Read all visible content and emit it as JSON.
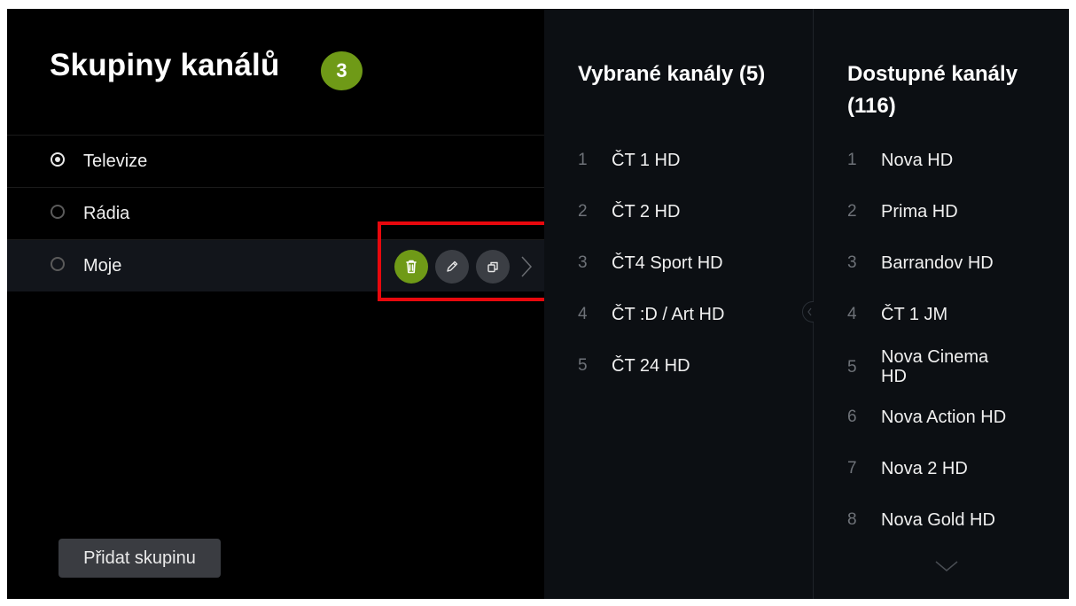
{
  "left": {
    "title": "Skupiny kanálů",
    "count": "3",
    "groups": [
      {
        "label": "Televize",
        "checked": true
      },
      {
        "label": "Rádia",
        "checked": false
      },
      {
        "label": "Moje",
        "checked": false
      }
    ],
    "actions": [
      "trash-icon",
      "pencil-icon",
      "copy-icon",
      "chevron-right-icon"
    ],
    "add_button": "Přidat skupinu"
  },
  "selected_channels": {
    "title": "Vybrané kanály (5)",
    "items": [
      {
        "num": "1",
        "name": "ČT 1 HD"
      },
      {
        "num": "2",
        "name": "ČT 2 HD"
      },
      {
        "num": "3",
        "name": "ČT4 Sport HD"
      },
      {
        "num": "4",
        "name": "ČT :D / Art HD"
      },
      {
        "num": "5",
        "name": "ČT 24 HD"
      }
    ]
  },
  "available_channels": {
    "title": "Dostupné kanály (116)",
    "items": [
      {
        "num": "1",
        "name": "Nova HD"
      },
      {
        "num": "2",
        "name": "Prima HD"
      },
      {
        "num": "3",
        "name": "Barrandov HD"
      },
      {
        "num": "4",
        "name": "ČT 1 JM"
      },
      {
        "num": "5",
        "name": "Nova Cinema HD"
      },
      {
        "num": "6",
        "name": "Nova Action HD"
      },
      {
        "num": "7",
        "name": "Nova 2 HD"
      },
      {
        "num": "8",
        "name": "Nova Gold HD"
      }
    ]
  },
  "colors": {
    "accent": "#6f9a17",
    "highlight": "#e8080d",
    "panel_bg": "#0c0f13"
  }
}
